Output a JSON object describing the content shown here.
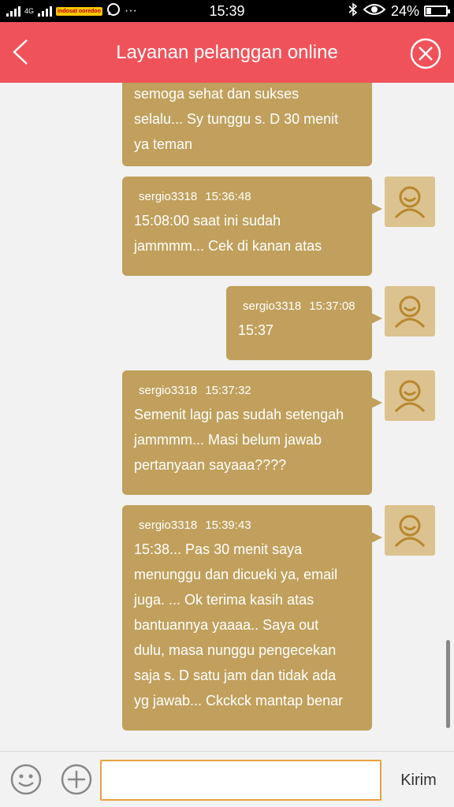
{
  "status_bar": {
    "network": "4G",
    "carrier_badge": "indosat ooredoo",
    "more": "···",
    "time": "15:39",
    "battery_percent": "24%",
    "battery_level": 0.24,
    "icons": [
      "signal-icon",
      "whatsapp-icon",
      "bluetooth-icon",
      "eye-icon",
      "battery-icon"
    ]
  },
  "header": {
    "title": "Layanan pelanggan online",
    "back_icon": "chevron-left-icon",
    "close_icon": "close-circle-icon"
  },
  "messages": [
    {
      "user": "",
      "time": "",
      "lines": [
        "semoga sehat dan sukses",
        "selalu... Sy tunggu s. D 30 menit",
        "ya teman"
      ]
    },
    {
      "user": "sergio3318",
      "time": "15:36:48",
      "lines": [
        "15:08:00 saat ini sudah",
        "jammmm... Cek di kanan atas"
      ]
    },
    {
      "user": "sergio3318",
      "time": "15:37:08",
      "lines": [
        "15:37"
      ]
    },
    {
      "user": "sergio3318",
      "time": "15:37:32",
      "lines": [
        "Semenit lagi pas sudah setengah",
        "jammmm... Masi belum jawab",
        "pertanyaan sayaaa????"
      ]
    },
    {
      "user": "sergio3318",
      "time": "15:39:43",
      "lines": [
        "15:38... Pas 30 menit saya",
        "menunggu dan dicueki ya, email",
        "juga. ... Ok terima kasih atas",
        "bantuannya yaaaa.. Saya out",
        "dulu, masa nunggu pengecekan",
        "saja s. D satu jam dan tidak ada",
        "yg jawab... Ckckck mantap benar"
      ]
    }
  ],
  "composer": {
    "input_value": "",
    "send_label": "Kirim",
    "emoji_icon": "smiley-icon",
    "plus_icon": "plus-circle-icon"
  },
  "colors": {
    "header": "#f0525a",
    "bubble": "#c0a05c",
    "avatar": "#dcc28e",
    "input_border": "#e8a33d"
  }
}
